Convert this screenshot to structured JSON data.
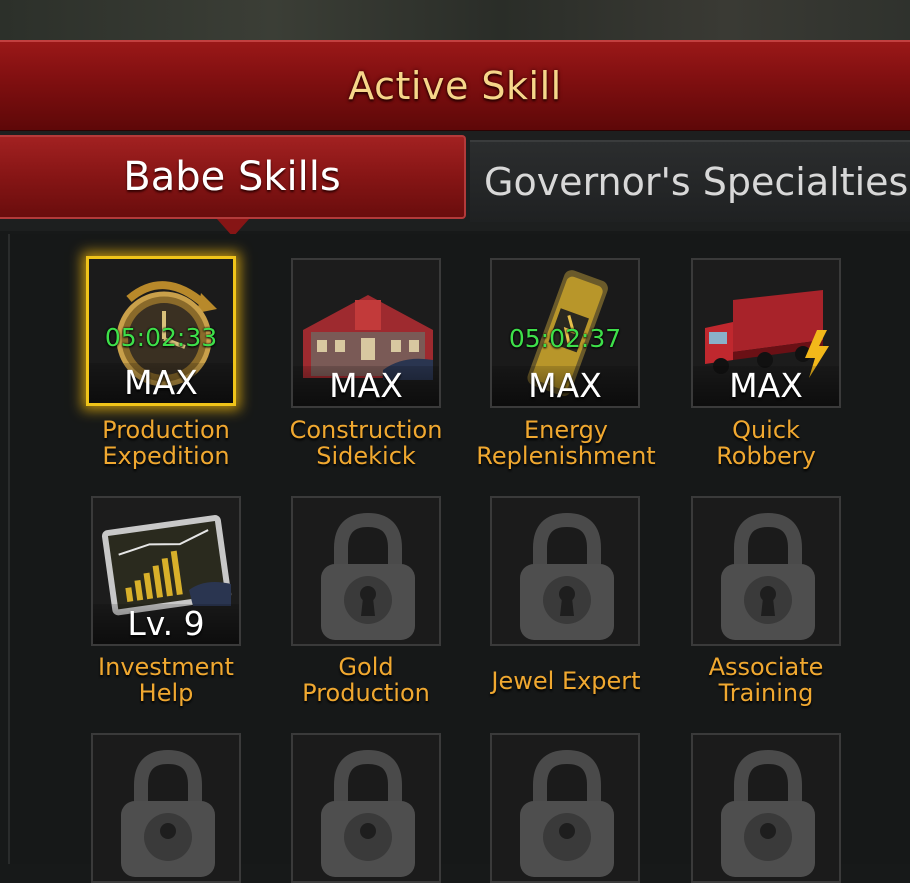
{
  "header": {
    "title": "Active Skill"
  },
  "tabs": [
    {
      "label": "Babe Skills",
      "active": true
    },
    {
      "label": "Governor's Specialties",
      "active": false
    }
  ],
  "skills": [
    {
      "name_line1": "Production",
      "name_line2": "Expedition",
      "level": "MAX",
      "timer": "05:02:33",
      "icon": "clock-icon",
      "selected": true
    },
    {
      "name_line1": "Construction",
      "name_line2": "Sidekick",
      "level": "MAX",
      "timer": "",
      "icon": "building-icon"
    },
    {
      "name_line1": "Energy",
      "name_line2": "Replenishment",
      "level": "MAX",
      "timer": "05:02:37",
      "icon": "energy-drink-icon"
    },
    {
      "name_line1": "Quick",
      "name_line2": "Robbery",
      "level": "MAX",
      "timer": "",
      "icon": "truck-icon"
    },
    {
      "name_line1": "Investment",
      "name_line2": "Help",
      "level": "Lv. 9",
      "timer": "",
      "icon": "tablet-chart-icon"
    },
    {
      "name_line1": "Gold",
      "name_line2": "Production",
      "level": "",
      "timer": "",
      "icon": "lock-icon"
    },
    {
      "name_line1": "Jewel Expert",
      "name_line2": "",
      "level": "",
      "timer": "",
      "icon": "lock-icon"
    },
    {
      "name_line1": "Associate",
      "name_line2": "Training",
      "level": "",
      "timer": "",
      "icon": "lock-icon"
    },
    {
      "name_line1": "",
      "name_line2": "",
      "level": "",
      "timer": "",
      "icon": "lock-icon"
    },
    {
      "name_line1": "",
      "name_line2": "",
      "level": "",
      "timer": "",
      "icon": "lock-icon"
    },
    {
      "name_line1": "",
      "name_line2": "",
      "level": "",
      "timer": "",
      "icon": "lock-icon"
    },
    {
      "name_line1": "",
      "name_line2": "",
      "level": "",
      "timer": "",
      "icon": "lock-icon"
    }
  ],
  "colors": {
    "accent_red": "#861515",
    "label_orange": "#f0a830",
    "timer_green": "#3ee04a",
    "select_gold": "#f0c419"
  }
}
